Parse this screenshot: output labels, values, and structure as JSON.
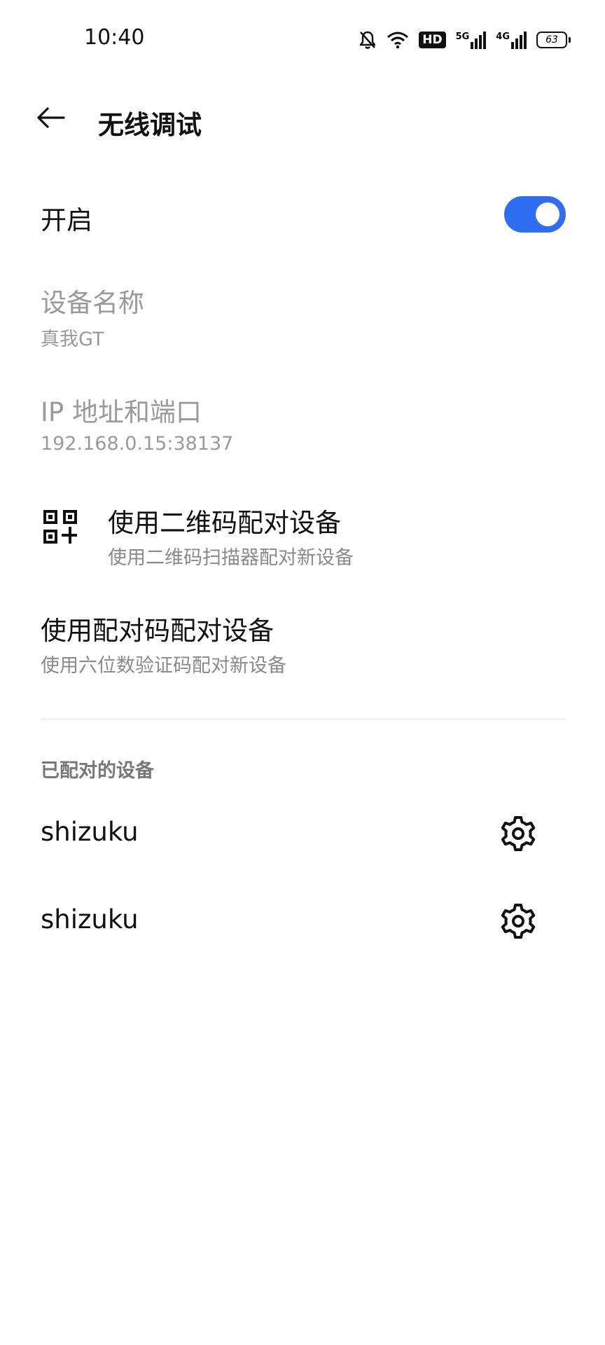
{
  "status_bar": {
    "time": "10:40",
    "icons": [
      "bell-off-icon",
      "wifi-icon",
      "hd-icon",
      "signal-5g-icon",
      "signal-4g-icon",
      "battery-icon"
    ],
    "hd_label": "HD",
    "net1_label": "5G",
    "net2_label": "4G",
    "battery_level": "63"
  },
  "header": {
    "back_icon": "arrow-left-icon",
    "title": "无线调试"
  },
  "toggle": {
    "label": "开启",
    "on": true,
    "accent_color": "#2f6ef0"
  },
  "device_name_item": {
    "title": "设备名称",
    "value": "真我GT"
  },
  "ip_item": {
    "title": "IP 地址和端口",
    "value": "192.168.0.15:38137"
  },
  "qr_pair_item": {
    "icon": "qr-code-icon",
    "title": "使用二维码配对设备",
    "subtitle": "使用二维码扫描器配对新设备"
  },
  "code_pair_item": {
    "title": "使用配对码配对设备",
    "subtitle": "使用六位数验证码配对新设备"
  },
  "paired_section": {
    "header": "已配对的设备",
    "devices": [
      {
        "name": "shizuku",
        "icon": "gear-icon"
      },
      {
        "name": "shizuku",
        "icon": "gear-icon"
      }
    ]
  }
}
